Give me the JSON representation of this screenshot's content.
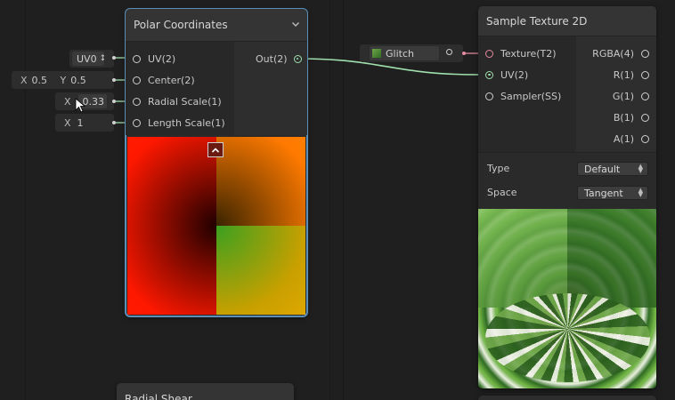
{
  "polar_node": {
    "title": "Polar Coordinates",
    "inputs": [
      {
        "label": "UV(2)"
      },
      {
        "label": "Center(2)"
      },
      {
        "label": "Radial Scale(1)"
      },
      {
        "label": "Length Scale(1)"
      }
    ],
    "output": {
      "label": "Out(2)"
    }
  },
  "uv_input": {
    "value": "UV0",
    "arrow": "↕"
  },
  "center_input": {
    "x_label": "X",
    "x_value": "0.5",
    "y_label": "Y",
    "y_value": "0.5"
  },
  "radial_input": {
    "x_label": "X",
    "x_value": "0.33"
  },
  "length_input": {
    "x_label": "X",
    "x_value": "1"
  },
  "texture_input": {
    "value": "Glitch"
  },
  "sample_node": {
    "title": "Sample Texture 2D",
    "inputs": [
      {
        "label": "Texture(T2)"
      },
      {
        "label": "UV(2)"
      },
      {
        "label": "Sampler(SS)"
      }
    ],
    "outputs": [
      {
        "label": "RGBA(4)"
      },
      {
        "label": "R(1)"
      },
      {
        "label": "G(1)"
      },
      {
        "label": "B(1)"
      },
      {
        "label": "A(1)"
      }
    ],
    "type_label": "Type",
    "type_value": "Default",
    "space_label": "Space",
    "space_value": "Tangent"
  },
  "radial_shear_node": {
    "title": "Radial Shear"
  },
  "colors": {
    "selection": "#5b8fb8",
    "connection": "#9fe0ad",
    "canvas": "#1f1f1f"
  },
  "icons": [
    "chevron-down-icon",
    "chevron-up-icon",
    "cursor-icon",
    "texture-thumb-icon"
  ]
}
